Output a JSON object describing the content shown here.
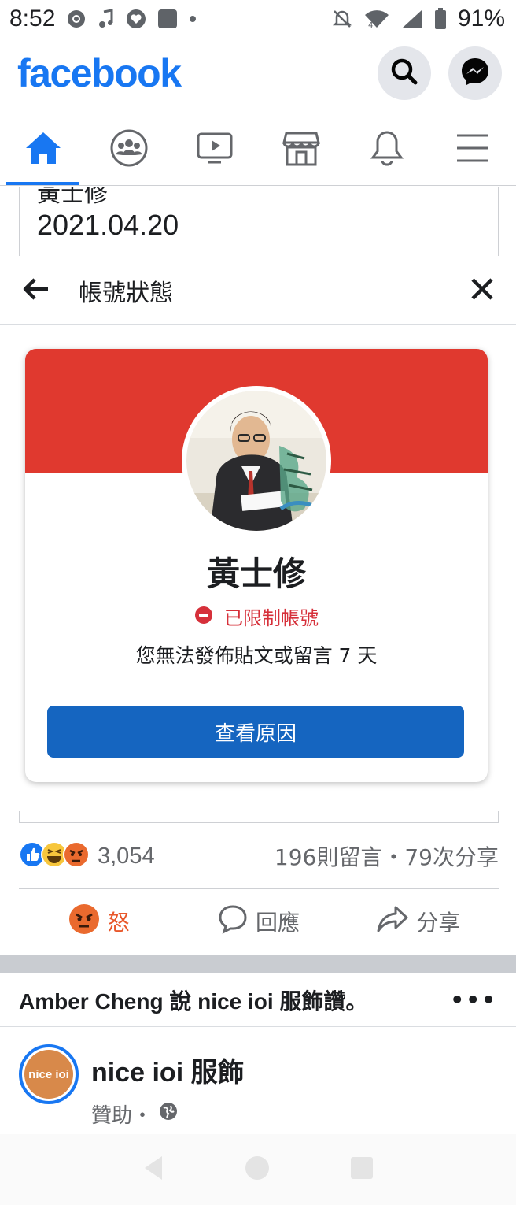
{
  "status_bar": {
    "time": "8:52",
    "battery": "91%",
    "network": "4"
  },
  "app": {
    "logo": "facebook",
    "brand_color": "#1877f2"
  },
  "nav_tabs": [
    {
      "name": "home",
      "icon": "home-icon",
      "active": true
    },
    {
      "name": "groups",
      "icon": "groups-icon"
    },
    {
      "name": "watch",
      "icon": "video-icon"
    },
    {
      "name": "marketplace",
      "icon": "store-icon"
    },
    {
      "name": "notifications",
      "icon": "bell-icon"
    },
    {
      "name": "menu",
      "icon": "hamburger-icon"
    }
  ],
  "post_snippet": {
    "name": "黃士修",
    "date": "2021.04.20"
  },
  "sheet": {
    "title": "帳號狀態",
    "card": {
      "name": "黃士修",
      "status_label": "已限制帳號",
      "description": "您無法發佈貼文或留言 7 天",
      "button": "查看原因",
      "banner_color": "#e0392f",
      "button_color": "#1565c0"
    }
  },
  "post_stats": {
    "reactions_count": "3,054",
    "counts_text": "196則留言・79次分享",
    "reaction_icons": [
      "like-icon",
      "haha-icon",
      "angry-icon"
    ]
  },
  "actions": {
    "reaction": "怒",
    "comment": "回應",
    "share": "分享"
  },
  "activity": {
    "text": "Amber Cheng 說 nice ioi 服飾讚。",
    "more": "•••"
  },
  "ad": {
    "page_name": "nice ioi 服飾",
    "logo_text": "nice ioi",
    "sponsored": "贊助・"
  }
}
